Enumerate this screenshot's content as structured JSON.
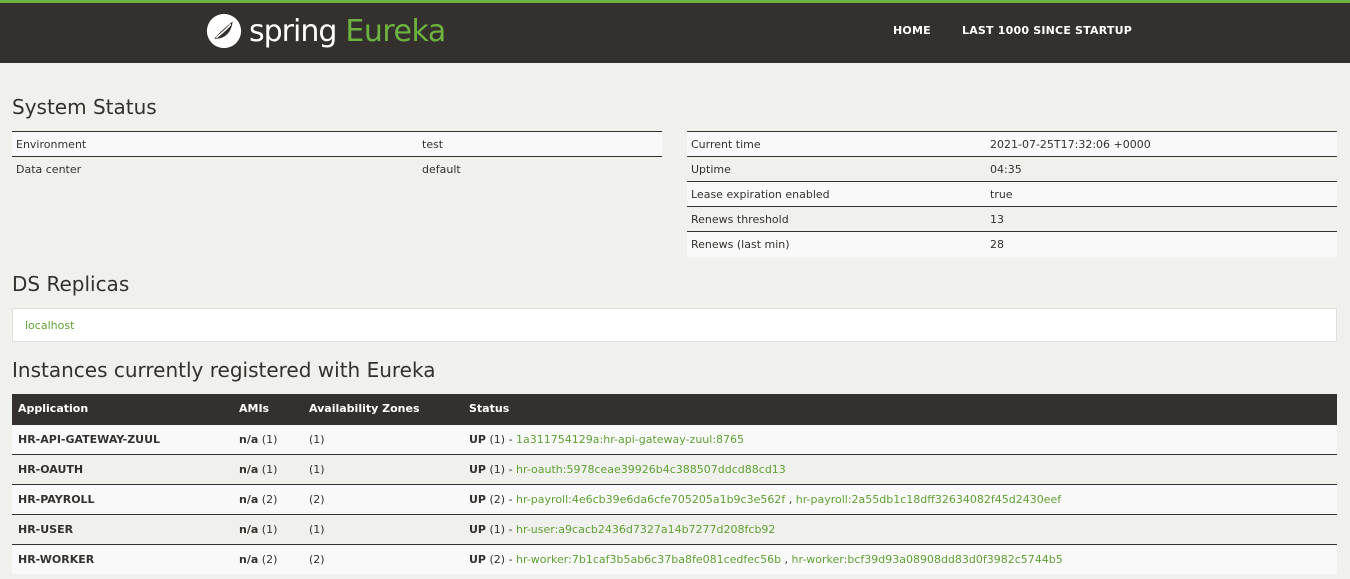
{
  "nav": {
    "brand_spring": "spring",
    "brand_eureka": "Eureka",
    "home": "HOME",
    "last1000": "LAST 1000 SINCE STARTUP"
  },
  "system_status": {
    "title": "System Status",
    "left": [
      {
        "key": "Environment",
        "value": "test"
      },
      {
        "key": "Data center",
        "value": "default"
      }
    ],
    "right": [
      {
        "key": "Current time",
        "value": "2021-07-25T17:32:06 +0000"
      },
      {
        "key": "Uptime",
        "value": "04:35"
      },
      {
        "key": "Lease expiration enabled",
        "value": "true"
      },
      {
        "key": "Renews threshold",
        "value": "13"
      },
      {
        "key": "Renews (last min)",
        "value": "28"
      }
    ]
  },
  "ds_replicas": {
    "title": "DS Replicas",
    "items": [
      "localhost"
    ]
  },
  "instances": {
    "title": "Instances currently registered with Eureka",
    "headers": [
      "Application",
      "AMIs",
      "Availability Zones",
      "Status"
    ],
    "rows": [
      {
        "app": "HR-API-GATEWAY-ZUUL",
        "ami_label": "n/a",
        "ami_count": "(1)",
        "az": "(1)",
        "status": "UP",
        "status_count": "(1) - ",
        "links": [
          "1a311754129a:hr-api-gateway-zuul:8765"
        ]
      },
      {
        "app": "HR-OAUTH",
        "ami_label": "n/a",
        "ami_count": "(1)",
        "az": "(1)",
        "status": "UP",
        "status_count": "(1) - ",
        "links": [
          "hr-oauth:5978ceae39926b4c388507ddcd88cd13"
        ]
      },
      {
        "app": "HR-PAYROLL",
        "ami_label": "n/a",
        "ami_count": "(2)",
        "az": "(2)",
        "status": "UP",
        "status_count": "(2) - ",
        "links": [
          "hr-payroll:4e6cb39e6da6cfe705205a1b9c3e562f",
          "hr-payroll:2a55db1c18dff32634082f45d2430eef"
        ]
      },
      {
        "app": "HR-USER",
        "ami_label": "n/a",
        "ami_count": "(1)",
        "az": "(1)",
        "status": "UP",
        "status_count": "(1) - ",
        "links": [
          "hr-user:a9cacb2436d7327a14b7277d208fcb92"
        ]
      },
      {
        "app": "HR-WORKER",
        "ami_label": "n/a",
        "ami_count": "(2)",
        "az": "(2)",
        "status": "UP",
        "status_count": "(2) - ",
        "links": [
          "hr-worker:7b1caf3b5ab6c37ba8fe081cedfec56b",
          "hr-worker:bcf39d93a08908dd83d0f3982c5744b5"
        ]
      }
    ]
  },
  "colors": {
    "accent": "#6db33f",
    "nav_bg": "#34302d",
    "page_bg": "#f0f0ed"
  }
}
